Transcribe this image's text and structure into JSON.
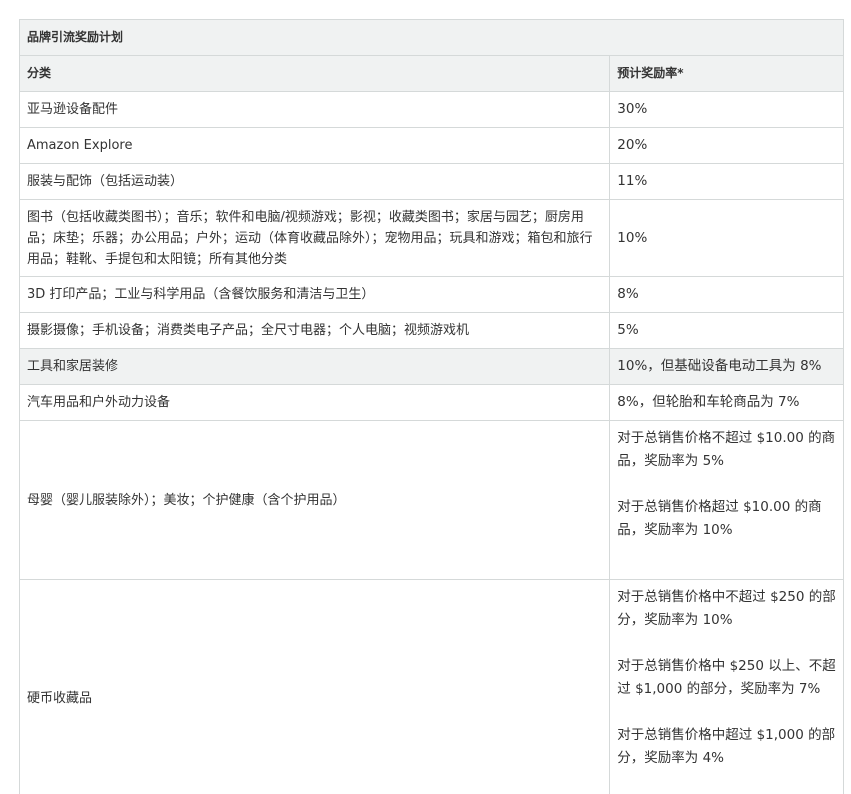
{
  "table": {
    "title": "品牌引流奖励计划",
    "headers": {
      "category": "分类",
      "rate": "预计奖励率*"
    },
    "rows": [
      {
        "category": "亚马逊设备配件",
        "rate": "30%"
      },
      {
        "category": "Amazon Explore",
        "rate": "20%"
      },
      {
        "category": "服装与配饰（包括运动装）",
        "rate": "11%"
      },
      {
        "category": "图书（包括收藏类图书）；音乐；软件和电脑/视频游戏；影视；收藏类图书；家居与园艺；厨房用品；床垫；乐器；办公用品；户外；运动（体育收藏品除外）；宠物用品；玩具和游戏；箱包和旅行用品；鞋靴、手提包和太阳镜；所有其他分类",
        "rate": "10%"
      },
      {
        "category": "3D 打印产品；工业与科学用品（含餐饮服务和清洁与卫生）",
        "rate": "8%"
      },
      {
        "category": "摄影摄像；手机设备；消费类电子产品；全尺寸电器；个人电脑；视频游戏机",
        "rate": "5%"
      },
      {
        "category": "工具和家居装修",
        "rate": "10%，但基础设备电动工具为 8%"
      },
      {
        "category": "汽车用品和户外动力设备",
        "rate": "8%，但轮胎和车轮商品为 7%"
      },
      {
        "category": "母婴（婴儿服装除外）；美妆；个护健康（含个护用品）",
        "rate_lines": [
          "对于总销售价格不超过 $10.00 的商品，奖励率为 5%",
          "对于总销售价格超过 $10.00 的商品，奖励率为 10%"
        ]
      },
      {
        "category": "硬币收藏品",
        "rate_lines": [
          "对于总销售价格中不超过 $250 的部分，奖励率为 10%",
          "对于总销售价格中 $250 以上、不超过 $1,000 的部分，奖励率为 7%",
          "对于总销售价格中超过 $1,000 的部分，奖励率为 4%"
        ]
      }
    ]
  },
  "colors": {
    "header_bg": "#f0f2f2",
    "border": "#d5d9d9",
    "text": "#333333"
  }
}
